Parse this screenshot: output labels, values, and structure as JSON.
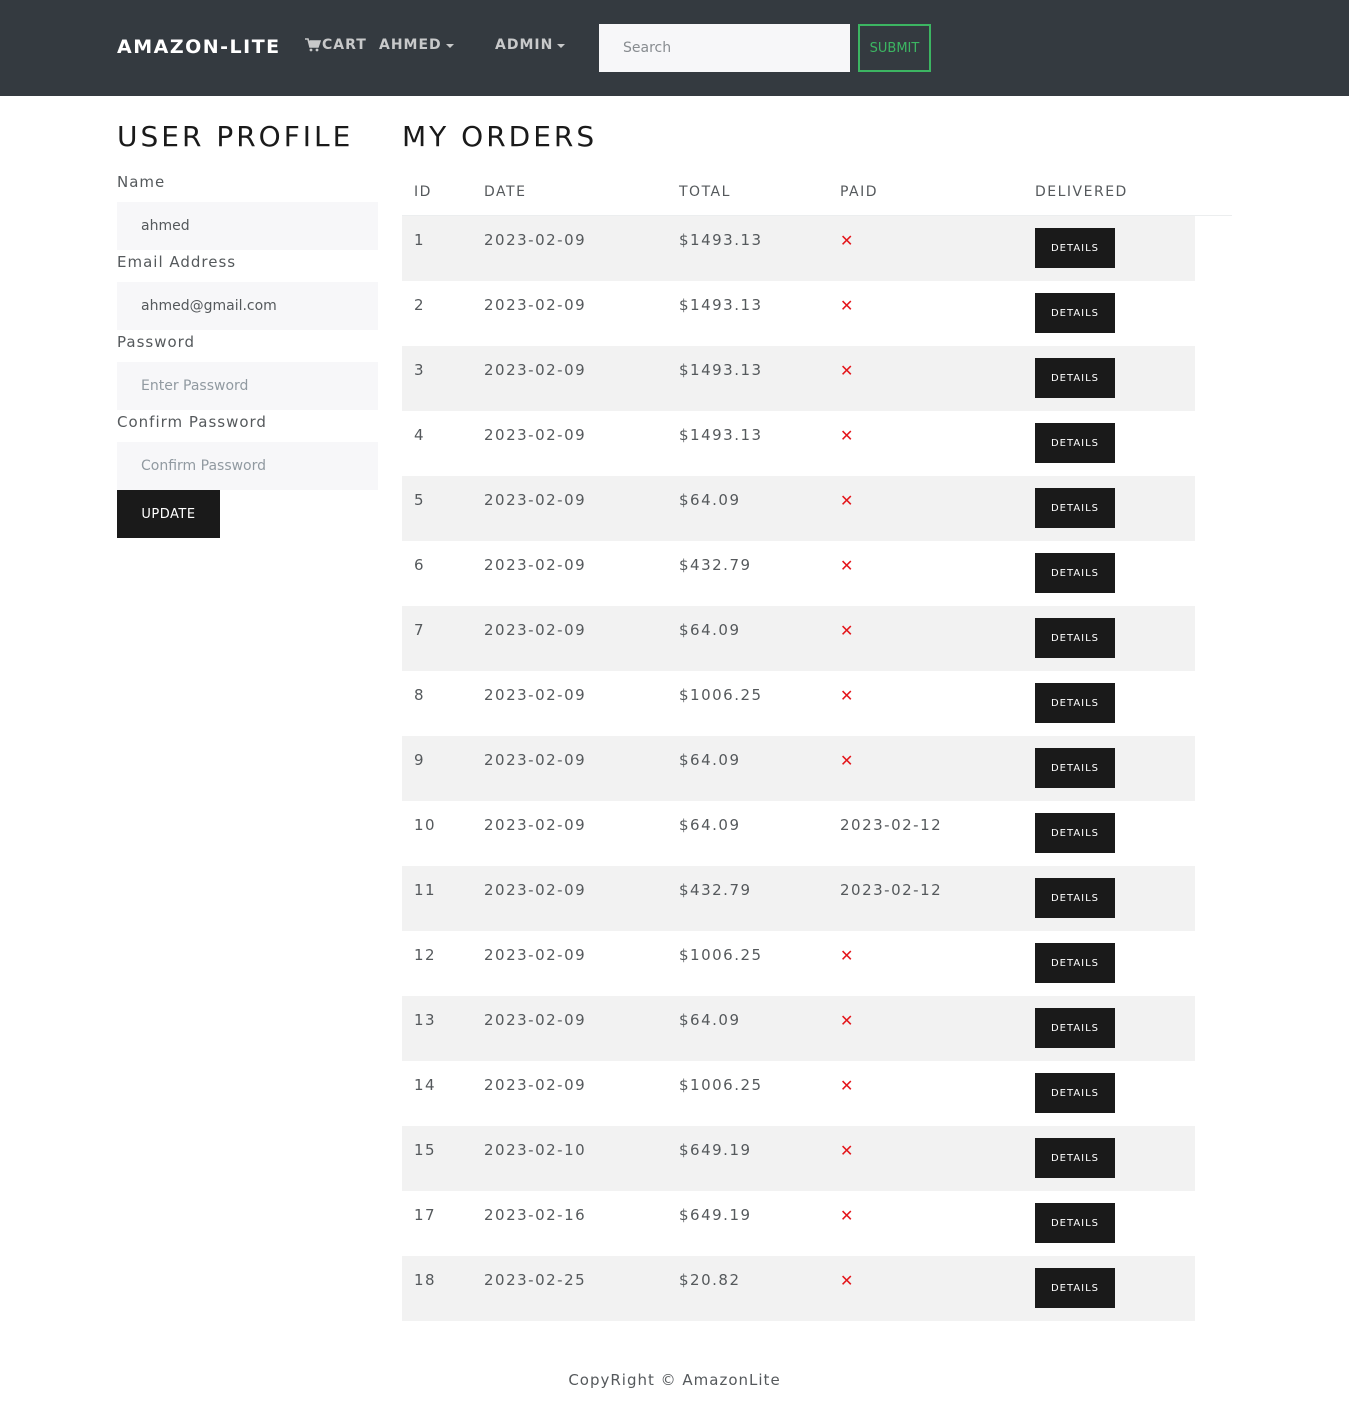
{
  "navbar": {
    "brand": "AMAZON-LITE",
    "cart_label": "CART",
    "user_menu_label": "AHMED",
    "admin_menu_label": "ADMIN",
    "search_placeholder": "Search",
    "submit_label": "SUBMIT",
    "cart_icon": "cart-icon",
    "submit_color": "#3cb562",
    "background_color": "#343a40"
  },
  "profile": {
    "title": "USER PROFILE",
    "name_label": "Name",
    "name_value": "ahmed",
    "email_label": "Email Address",
    "email_value": "ahmed@gmail.com",
    "password_label": "Password",
    "password_placeholder": "Enter Password",
    "confirm_label": "Confirm Password",
    "confirm_placeholder": "Confirm Password",
    "update_label": "UPDATE"
  },
  "orders": {
    "title": "MY ORDERS",
    "columns": [
      "ID",
      "DATE",
      "TOTAL",
      "PAID",
      "DELIVERED"
    ],
    "details_label": "DETAILS",
    "not_paid_icon": "x-mark-icon",
    "not_paid_color": "#e4161b",
    "rows": [
      {
        "id": "1",
        "date": "2023-02-09",
        "total": "$1493.13",
        "paid": null
      },
      {
        "id": "2",
        "date": "2023-02-09",
        "total": "$1493.13",
        "paid": null
      },
      {
        "id": "3",
        "date": "2023-02-09",
        "total": "$1493.13",
        "paid": null
      },
      {
        "id": "4",
        "date": "2023-02-09",
        "total": "$1493.13",
        "paid": null
      },
      {
        "id": "5",
        "date": "2023-02-09",
        "total": "$64.09",
        "paid": null
      },
      {
        "id": "6",
        "date": "2023-02-09",
        "total": "$432.79",
        "paid": null
      },
      {
        "id": "7",
        "date": "2023-02-09",
        "total": "$64.09",
        "paid": null
      },
      {
        "id": "8",
        "date": "2023-02-09",
        "total": "$1006.25",
        "paid": null
      },
      {
        "id": "9",
        "date": "2023-02-09",
        "total": "$64.09",
        "paid": null
      },
      {
        "id": "10",
        "date": "2023-02-09",
        "total": "$64.09",
        "paid": "2023-02-12"
      },
      {
        "id": "11",
        "date": "2023-02-09",
        "total": "$432.79",
        "paid": "2023-02-12"
      },
      {
        "id": "12",
        "date": "2023-02-09",
        "total": "$1006.25",
        "paid": null
      },
      {
        "id": "13",
        "date": "2023-02-09",
        "total": "$64.09",
        "paid": null
      },
      {
        "id": "14",
        "date": "2023-02-09",
        "total": "$1006.25",
        "paid": null
      },
      {
        "id": "15",
        "date": "2023-02-10",
        "total": "$649.19",
        "paid": null
      },
      {
        "id": "17",
        "date": "2023-02-16",
        "total": "$649.19",
        "paid": null
      },
      {
        "id": "18",
        "date": "2023-02-25",
        "total": "$20.82",
        "paid": null
      }
    ]
  },
  "footer": {
    "text": "CopyRight © AmazonLite"
  }
}
